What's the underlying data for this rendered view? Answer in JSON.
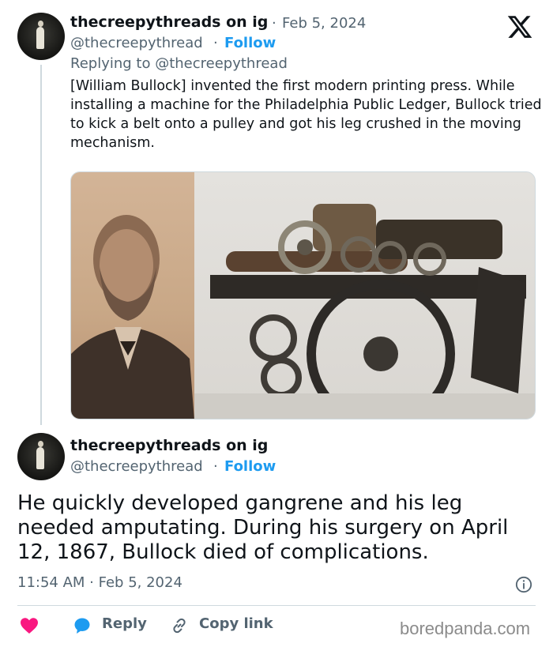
{
  "tweet1": {
    "name": "thecreepythreads on ig",
    "date": "Feb 5, 2024",
    "handle": "@thecreepythread",
    "follow": "Follow",
    "replying_to": "Replying to @thecreepythread",
    "text": "[William Bullock] invented the first modern printing press. While installing a machine for the Philadelphia Public Ledger, Bullock tried to kick a belt onto a pulley and got his leg crushed in the moving mechanism."
  },
  "tweet2": {
    "name": "thecreepythreads on ig",
    "handle": "@thecreepythread",
    "follow": "Follow",
    "text": "He quickly developed gangrene and his leg needed amputating. During his surgery on April 12, 1867, Bullock died of complications.",
    "timestamp": "11:54 AM · Feb 5, 2024"
  },
  "actions": {
    "reply": "Reply",
    "copy_link": "Copy link"
  },
  "watermark": "boredpanda.com",
  "icons": [
    "x-logo-icon",
    "info-icon",
    "heart-icon",
    "reply-bubble-icon",
    "link-icon"
  ],
  "colors": {
    "accent": "#1d9bf0",
    "heart": "#f91880",
    "secondary_text": "#536471"
  }
}
